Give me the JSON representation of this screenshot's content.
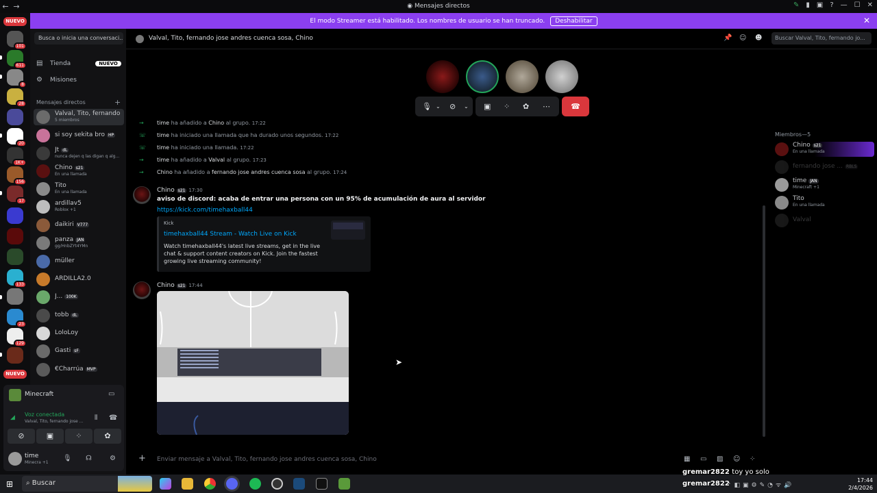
{
  "window": {
    "title": "Mensajes directos"
  },
  "banner": {
    "text": "El modo Streamer está habilitado. Los nombres de usuario se han truncado.",
    "button": "Deshabilitar"
  },
  "rail": {
    "nuevo_top": "NUEVO",
    "nuevo_bottom": "NUEVO",
    "badges": [
      "101",
      "611",
      "8",
      "28",
      "20",
      "1K+",
      "156",
      "17",
      "133",
      "23",
      "129"
    ]
  },
  "sidebar": {
    "search_placeholder": "Busca o inicia una conversaci...",
    "nav": [
      {
        "label": "Tienda",
        "badge": "NUEVO"
      },
      {
        "label": "Misiones"
      }
    ],
    "dm_header": "Mensajes directos",
    "dms": [
      {
        "name": "Valval, Tito, fernando j...",
        "sub": "5 miembros",
        "color": "#6b6b6b"
      },
      {
        "name": "si soy sekita bro",
        "tag": "HP",
        "color": "#c9739a"
      },
      {
        "name": "Jt",
        "tag": "dL",
        "sub": "nunca dejen q las digan q alg...",
        "color": "#3a3a3a"
      },
      {
        "name": "Chino",
        "tag": "s21",
        "sub": "En una llamada",
        "color": "#5a1010"
      },
      {
        "name": "Tito",
        "sub": "En una llamada",
        "color": "#8a8a8a"
      },
      {
        "name": "ardillav5",
        "sub": "Roblox +1",
        "color": "#bdbdbd"
      },
      {
        "name": "daikiri",
        "tag": "V777",
        "color": "#8b5a3a"
      },
      {
        "name": "panza",
        "tag": "JAN",
        "sub": "gg/HnbZYt4YMn",
        "color": "#7a7a7a"
      },
      {
        "name": "müller",
        "color": "#4a6aa8"
      },
      {
        "name": "ARDILLA2.0",
        "color": "#c77a2a"
      },
      {
        "name": "J...",
        "tag": "100K",
        "color": "#6aa86a"
      },
      {
        "name": "tobb",
        "tag": "dL",
        "color": "#4a4a4a"
      },
      {
        "name": "LoloLoy",
        "color": "#d8d8d8"
      },
      {
        "name": "Gasti",
        "tag": "sF",
        "color": "#6a6a6a"
      },
      {
        "name": "€Charrúa",
        "tag": "MVP",
        "color": "#5a5a5a"
      }
    ]
  },
  "voice_panel": {
    "game": "Minecraft",
    "status": "Voz conectada",
    "channel": "Valval, Tito, fernando jose ...",
    "user": "time",
    "user_status": "Minecra +1"
  },
  "channel": {
    "title": "Valval, Tito, fernando jose andres cuenca sosa, Chino",
    "search_placeholder": "Buscar Valval, Tito, fernando jo..."
  },
  "system_messages": [
    {
      "user": "time",
      "text": "ha añadido a",
      "target": "Chino",
      "suffix": "al grupo.",
      "time": "17:22"
    },
    {
      "user": "time",
      "text": "ha iniciado una llamada que ha durado unos segundos.",
      "time": "17:22"
    },
    {
      "user": "time",
      "text": "ha iniciado una llamada.",
      "time": "17:22"
    },
    {
      "user": "time",
      "text": "ha añadido a",
      "target": "Valval",
      "suffix": "al grupo.",
      "time": "17:23"
    },
    {
      "user": "Chino",
      "text": "ha añadido a",
      "target": "fernando jose andres cuenca sosa",
      "suffix": "al grupo.",
      "time": "17:24"
    }
  ],
  "message1": {
    "author": "Chino",
    "tag": "s21",
    "time": "17:30",
    "text": "aviso de discord: acaba de entrar una persona con un 95% de acumulación de aura al servidor",
    "link": "https://kick.com/timehaxball44",
    "embed": {
      "provider": "Kick",
      "title": "timehaxball44 Stream - Watch Live on Kick",
      "description": "Watch timehaxball44's latest live streams, get in the live chat & support content creators on Kick. Join the fastest growing live streaming community!"
    }
  },
  "message2": {
    "author": "Chino",
    "tag": "s21",
    "time": "17:44"
  },
  "composer": {
    "placeholder": "Enviar mensaje a Valval, Tito, fernando jose andres cuenca sosa, Chino"
  },
  "members": {
    "header": "Miembros—5",
    "list": [
      {
        "name": "Chino",
        "tag": "s21",
        "sub": "En una llamada",
        "color": "#5a1010"
      },
      {
        "name": "fernando jose ...",
        "tag": "RBLS",
        "dim": true,
        "color": "#555"
      },
      {
        "name": "time",
        "tag": "JAN",
        "sub": "Minecraft +1",
        "color": "#9a9a9a"
      },
      {
        "name": "Tito",
        "sub": "En una llamada",
        "color": "#8a8a8a"
      },
      {
        "name": "Valval",
        "dim": true,
        "color": "#555"
      }
    ]
  },
  "taskbar": {
    "search": "Buscar",
    "time": "17:44",
    "date": "2/4/2026"
  },
  "stream_overlay": [
    {
      "user": "gremar2822",
      "text": "toy yo solo"
    },
    {
      "user": "gremar2822",
      "text": ""
    }
  ],
  "colors": {
    "accent": "#8b3ff0",
    "danger": "#da373c",
    "online": "#23a55a",
    "link": "#00a8fc"
  }
}
